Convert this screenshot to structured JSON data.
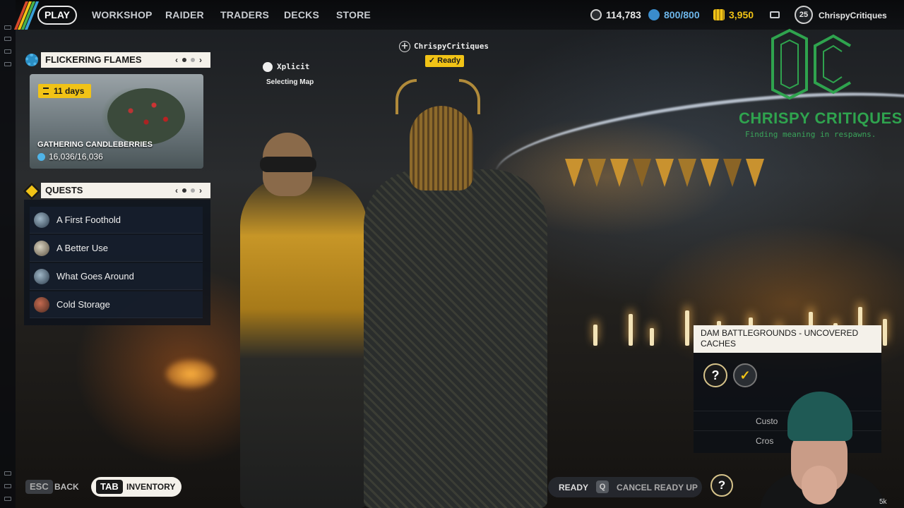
{
  "nav": {
    "items": [
      "PLAY",
      "WORKSHOP",
      "RAIDER",
      "TRADERS",
      "DECKS",
      "STORE"
    ]
  },
  "currencies": {
    "coins": "114,783",
    "credits": "800/800",
    "tickets": "3,950"
  },
  "profile": {
    "level": "25",
    "username": "ChrispyCritiques"
  },
  "event": {
    "header": "FLICKERING FLAMES",
    "timer": "11 days",
    "name": "GATHERING CANDLEBERRIES",
    "progress": "16,036/16,036"
  },
  "quests": {
    "header": "QUESTS",
    "items": [
      {
        "label": "A First Foothold"
      },
      {
        "label": "A Better Use"
      },
      {
        "label": "What Goes Around"
      },
      {
        "label": "Cold Storage"
      }
    ]
  },
  "party": {
    "member1_name": "Xplicit",
    "member1_status": "Selecting Map",
    "member2_name": "ChrispyCritiques",
    "member2_status": "Ready"
  },
  "overlay": {
    "logo_text": "OC",
    "title": "CHRISPY CRITIQUES",
    "subtitle": "Finding meaning in respawns."
  },
  "map_card": {
    "title": "DAM BATTLEGROUNDS - UNCOVERED CACHES",
    "slot_unknown": "?",
    "slot_ready": "✓",
    "row1": "Custo",
    "row2": "Cros"
  },
  "bottom": {
    "esc_key": "ESC",
    "back_label": "BACK",
    "tab_key": "TAB",
    "inventory_label": "INVENTORY",
    "ready_label": "READY",
    "q_key": "Q",
    "cancel_label": "CANCEL READY UP",
    "slot_unknown": "?",
    "viewer_count": "5k"
  },
  "pager": {
    "prev": "‹",
    "next": "›"
  },
  "colors": {
    "accent_yellow": "#f1c316",
    "overlay_green": "#2fa34e",
    "panel_cream": "#f4f1ea"
  }
}
